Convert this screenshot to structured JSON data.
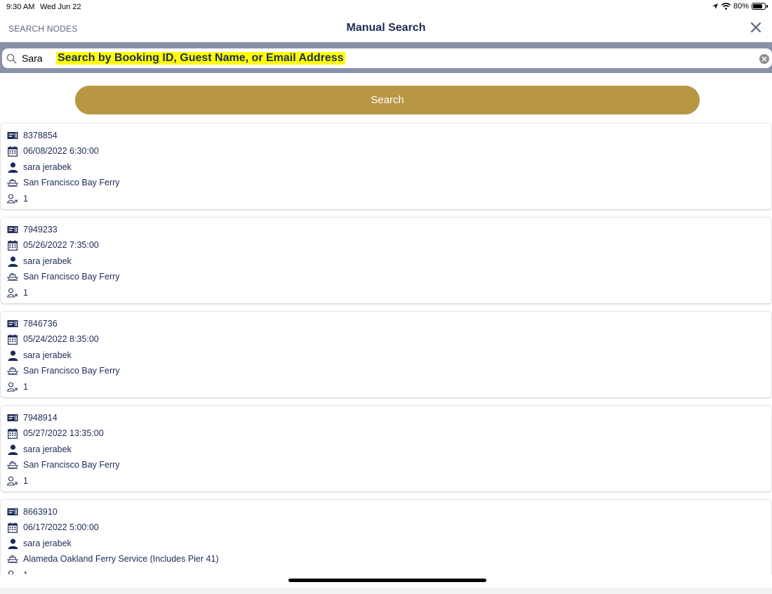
{
  "status_bar": {
    "time": "9:30 AM",
    "date": "Wed Jun 22",
    "battery_text": "80%",
    "battery_level": 0.8
  },
  "nav": {
    "left_label": "SEARCH NODES",
    "title": "Manual Search"
  },
  "search": {
    "value": "Sara",
    "hint": "Search by Booking ID, Guest Name, or Email Address"
  },
  "search_button_label": "Search",
  "results": [
    {
      "booking_id": "8378854",
      "datetime": "06/08/2022 6:30:00",
      "guest": "sara jerabek",
      "operator": "San Francisco Bay Ferry",
      "pax": "1"
    },
    {
      "booking_id": "7949233",
      "datetime": "05/26/2022 7:35:00",
      "guest": "sara jerabek",
      "operator": "San Francisco Bay Ferry",
      "pax": "1"
    },
    {
      "booking_id": "7846736",
      "datetime": "05/24/2022 8:35:00",
      "guest": "sara jerabek",
      "operator": "San Francisco Bay Ferry",
      "pax": "1"
    },
    {
      "booking_id": "7948914",
      "datetime": "05/27/2022 13:35:00",
      "guest": "sara jerabek",
      "operator": "San Francisco Bay Ferry",
      "pax": "1"
    },
    {
      "booking_id": "8663910",
      "datetime": "06/17/2022 5:00:00",
      "guest": "sara jerabek",
      "operator": "Alameda Oakland Ferry Service (Includes Pier 41)",
      "pax": "1"
    }
  ],
  "colors": {
    "accent_gold": "#b89743",
    "navy_text": "#1d2a57",
    "search_band": "#8791a8",
    "highlight": "#ffff00"
  },
  "icons": {
    "row_icons": [
      "ticket-icon",
      "calendar-icon",
      "person-icon",
      "ferry-icon",
      "passenger-count-icon"
    ]
  }
}
